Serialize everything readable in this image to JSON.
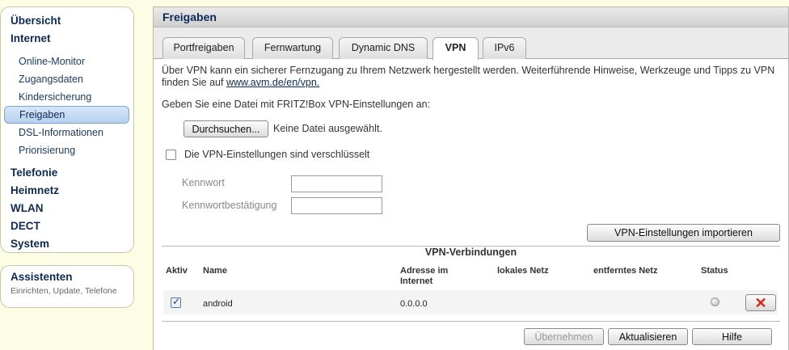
{
  "sidebar": {
    "main_items": [
      {
        "label": "Übersicht"
      },
      {
        "label": "Internet"
      }
    ],
    "internet_items": [
      {
        "label": "Online-Monitor"
      },
      {
        "label": "Zugangsdaten"
      },
      {
        "label": "Kindersicherung"
      },
      {
        "label": "Freigaben",
        "active": true
      },
      {
        "label": "DSL-Informationen"
      },
      {
        "label": "Priorisierung"
      }
    ],
    "lower_items": [
      {
        "label": "Telefonie"
      },
      {
        "label": "Heimnetz"
      },
      {
        "label": "WLAN"
      },
      {
        "label": "DECT"
      },
      {
        "label": "System"
      }
    ]
  },
  "assistant": {
    "title": "Assistenten",
    "subtitle": "Einrichten, Update, Telefone"
  },
  "page": {
    "title": "Freigaben",
    "tabs": [
      {
        "label": "Portfreigaben"
      },
      {
        "label": "Fernwartung"
      },
      {
        "label": "Dynamic DNS"
      },
      {
        "label": "VPN",
        "active": true
      },
      {
        "label": "IPv6"
      }
    ]
  },
  "vpn": {
    "intro_text": "Über VPN kann ein sicherer Fernzugang zu Ihrem Netzwerk hergestellt werden. Weiterführende Hinweise, Werkzeuge und Tipps zu VPN finden Sie auf",
    "intro_link": "www.avm.de/en/vpn.",
    "file_prompt": "Geben Sie eine Datei mit FRITZ!Box VPN-Einstellungen an:",
    "browse_label": "Durchsuchen...",
    "file_status": "Keine Datei ausgewählt.",
    "encrypted_label": "Die VPN-Einstellungen sind verschlüsselt",
    "encrypted_checked": false,
    "password_label": "Kennwort",
    "password_value": "",
    "password_confirm_label": "Kennwortbestätigung",
    "password_confirm_value": "",
    "import_label": "VPN-Einstellungen importieren"
  },
  "connections": {
    "title": "VPN-Verbindungen",
    "columns": {
      "active": "Aktiv",
      "name": "Name",
      "address": "Adresse im Internet",
      "local": "lokales Netz",
      "remote": "entferntes Netz",
      "status": "Status"
    },
    "rows": [
      {
        "active": true,
        "name": "android",
        "address": "0.0.0.0",
        "local": "",
        "remote": "",
        "status_icon": "status-gray-icon",
        "delete_icon": "delete-x-icon"
      }
    ]
  },
  "footer": {
    "apply_label": "Übernehmen",
    "refresh_label": "Aktualisieren",
    "help_label": "Hilfe"
  },
  "colors": {
    "nav_text": "#0d2a55",
    "delete_red": "#d9261c",
    "sidebar_bg": "#fdfde6"
  }
}
